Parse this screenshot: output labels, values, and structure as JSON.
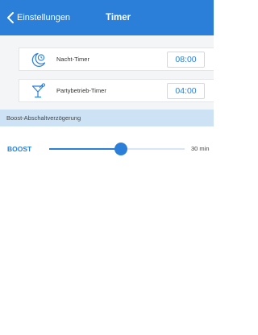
{
  "nav": {
    "back_label": "Einstellungen",
    "title": "Timer"
  },
  "timers": [
    {
      "icon": "moon-clock-icon",
      "label": "Nacht-Timer",
      "time": "08:00"
    },
    {
      "icon": "cocktail-glass-icon",
      "label": "Partybetrieb-Timer",
      "time": "04:00"
    }
  ],
  "section": {
    "title": "Boost-Abschaltverzögerung"
  },
  "boost": {
    "label": "BOOST",
    "value_label": "30 min",
    "slider_fraction": 0.53
  },
  "colors": {
    "accent": "#2b7fd9",
    "section_bg": "#cde3f5",
    "list_bg": "#f4f5f7"
  }
}
